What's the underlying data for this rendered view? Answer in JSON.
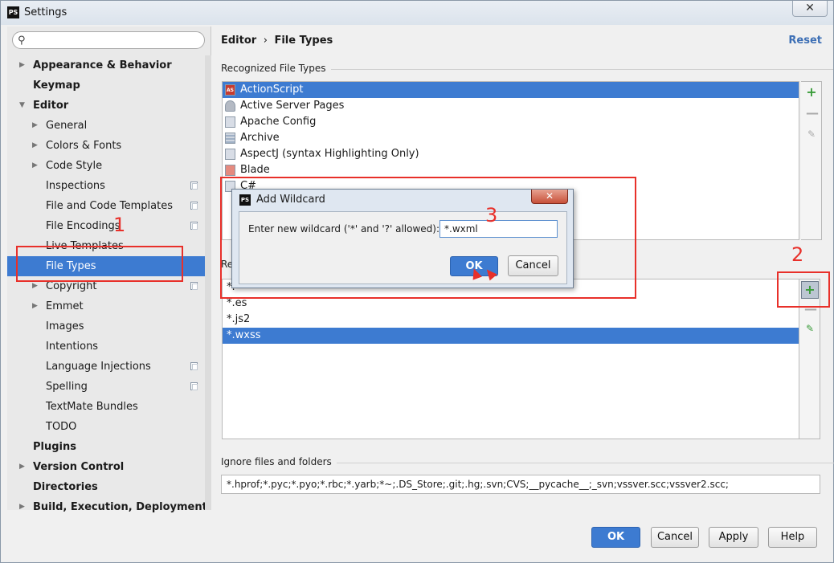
{
  "window": {
    "title": "Settings",
    "close_glyph": "✕"
  },
  "search": {
    "placeholder": ""
  },
  "tree": [
    {
      "label": "Appearance & Behavior",
      "bold": true,
      "level": 0,
      "arrow": "right"
    },
    {
      "label": "Keymap",
      "bold": true,
      "level": 0
    },
    {
      "label": "Editor",
      "bold": true,
      "level": 0,
      "arrow": "down"
    },
    {
      "label": "General",
      "level": 1,
      "arrow": "right"
    },
    {
      "label": "Colors & Fonts",
      "level": 1,
      "arrow": "right"
    },
    {
      "label": "Code Style",
      "level": 1,
      "arrow": "right"
    },
    {
      "label": "Inspections",
      "level": 2,
      "copy": true
    },
    {
      "label": "File and Code Templates",
      "level": 2,
      "copy": true
    },
    {
      "label": "File Encodings",
      "level": 2,
      "copy": true
    },
    {
      "label": "Live Templates",
      "level": 2
    },
    {
      "label": "File Types",
      "level": 2,
      "selected": true
    },
    {
      "label": "Copyright",
      "level": 1,
      "arrow": "right",
      "copy": true
    },
    {
      "label": "Emmet",
      "level": 1,
      "arrow": "right"
    },
    {
      "label": "Images",
      "level": 2
    },
    {
      "label": "Intentions",
      "level": 2
    },
    {
      "label": "Language Injections",
      "level": 2,
      "copy": true
    },
    {
      "label": "Spelling",
      "level": 2,
      "copy": true
    },
    {
      "label": "TextMate Bundles",
      "level": 2
    },
    {
      "label": "TODO",
      "level": 2
    },
    {
      "label": "Plugins",
      "bold": true,
      "level": 0
    },
    {
      "label": "Version Control",
      "bold": true,
      "level": 0,
      "arrow": "right"
    },
    {
      "label": "Directories",
      "bold": true,
      "level": 0
    },
    {
      "label": "Build, Execution, Deployment",
      "bold": true,
      "level": 0,
      "arrow": "right"
    }
  ],
  "breadcrumb": {
    "parent": "Editor",
    "separator": "›",
    "current": "File Types"
  },
  "reset_label": "Reset",
  "recognized": {
    "title": "Recognized File Types",
    "items": [
      {
        "label": "ActionScript",
        "icon": "as",
        "selected": true
      },
      {
        "label": "Active Server Pages",
        "icon": "ph"
      },
      {
        "label": "Apache Config",
        "icon": "doc"
      },
      {
        "label": "Archive",
        "icon": "arc"
      },
      {
        "label": "AspectJ (syntax Highlighting Only)",
        "icon": "doc"
      },
      {
        "label": "Blade",
        "icon": "blade"
      },
      {
        "label": "C#",
        "icon": "doc"
      }
    ]
  },
  "registered": {
    "title": "Re",
    "items": [
      {
        "label": "*.",
        "selected": false
      },
      {
        "label": "*.es",
        "selected": false
      },
      {
        "label": "*.js2",
        "selected": false
      },
      {
        "label": "*.wxss",
        "selected": true
      }
    ]
  },
  "toolbar": {
    "plus": "+",
    "minus": "—",
    "pencil": "✎"
  },
  "ignore": {
    "title": "Ignore files and folders",
    "value": "*.hprof;*.pyc;*.pyo;*.rbc;*.yarb;*~;.DS_Store;.git;.hg;.svn;CVS;__pycache__;_svn;vssver.scc;vssver2.scc;"
  },
  "footer": {
    "ok": "OK",
    "cancel": "Cancel",
    "apply": "Apply",
    "help": "Help"
  },
  "dialog": {
    "title": "Add Wildcard",
    "prompt": "Enter new wildcard ('*' and '?' allowed):",
    "value": "*.wxml",
    "ok": "OK",
    "cancel": "Cancel"
  },
  "annotations": {
    "n1": "1",
    "n2": "2",
    "n3": "3",
    "color": "#e8302a"
  },
  "colors": {
    "selection": "#3d7bd1",
    "accent": "#3d6fb5",
    "plus": "#3a9c3a"
  }
}
